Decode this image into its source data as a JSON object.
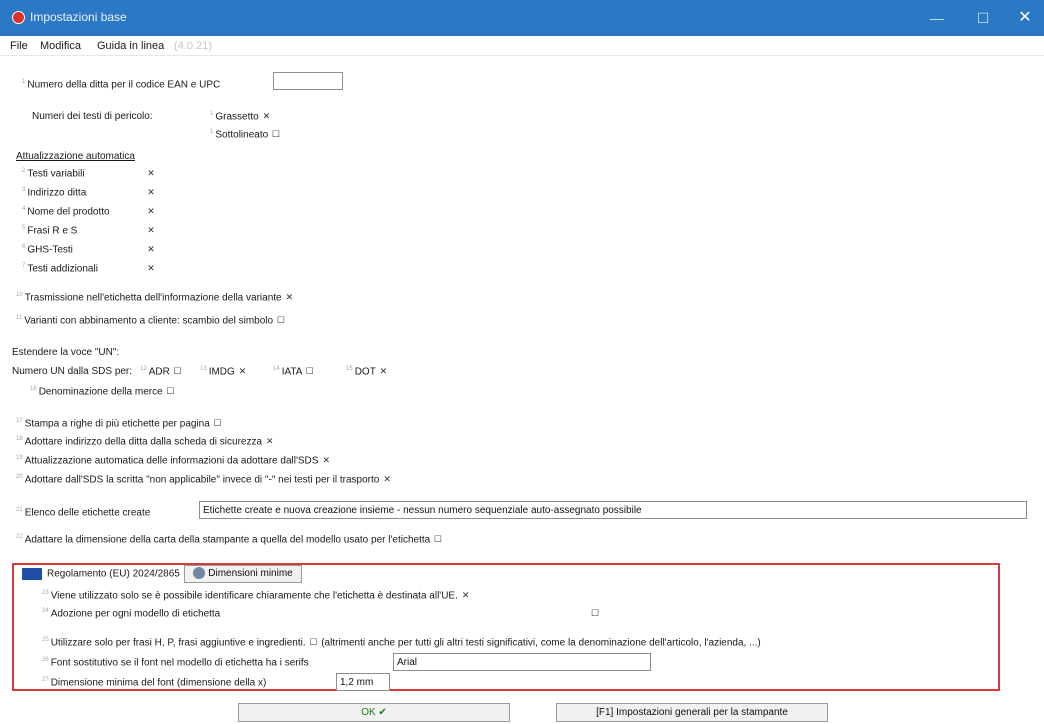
{
  "window": {
    "title": "Impostazioni base",
    "minimize": "—",
    "maximize": "☐",
    "close": "✕"
  },
  "menu": [
    "File",
    "Modifica",
    "Guida in linea",
    "(4.0.21)"
  ],
  "ean": {
    "label": "Numero della ditta per il codice EAN e UPC",
    "value": ""
  },
  "danger_texts": {
    "label": "Numeri dei testi di pericolo:",
    "bold": "Grassetto",
    "bold_check": "✕",
    "underline": "Sottolineato",
    "underline_check": "☐"
  },
  "auto_update": {
    "heading": "Attualizzazione automatica",
    "items": [
      {
        "label": "Testi variabili",
        "check": "✕"
      },
      {
        "label": "Indirizzo ditta",
        "check": "✕"
      },
      {
        "label": "Nome del prodotto",
        "check": "✕"
      },
      {
        "label": "Frasi R e S",
        "check": "✕"
      },
      {
        "label": "GHS-Testi",
        "check": "✕"
      },
      {
        "label": "Testi addizionali",
        "check": "✕"
      }
    ]
  },
  "variant_transmission": {
    "label": "Trasmissione nell'etichetta dell'informazione della variante",
    "check": "✕"
  },
  "variant_symbol": {
    "label": "Varianti con abbinamento a cliente: scambio del simbolo",
    "check": "☐"
  },
  "un": {
    "heading": "Estendere la voce \"UN\":",
    "label": "Numero UN dalla SDS per:",
    "options": [
      {
        "label": "ADR",
        "check": "☐"
      },
      {
        "label": "IMDG",
        "check": "✕"
      },
      {
        "label": "IATA",
        "check": "☐"
      },
      {
        "label": "DOT",
        "check": "✕"
      }
    ],
    "brand_label": "Denominazione della merce",
    "brand_check": "☐"
  },
  "print_rows": {
    "label": "Stampa a righe di più etichette per pagina",
    "check": "☐"
  },
  "adopt_address": {
    "label": "Adottare indirizzo della ditta dalla scheda di sicurezza",
    "check": "✕"
  },
  "auto_update_sds": {
    "label": "Attualizzazione automatica delle informazioni da adottare dall'SDS",
    "check": "✕"
  },
  "not_applicable": {
    "label": "Adottare dall'SDS la scritta \"non applicabile\" invece di \"-\" nei testi per il trasporto",
    "check": "✕"
  },
  "labels_list": {
    "label": "Elenco delle etichette create",
    "value": "Etichette create e nuova creazione insieme - nessun numero sequenziale auto-assegnato possibile"
  },
  "adapt_paper": {
    "label": "Adattare la dimensione della carta della stampante a quella del modello usato per l'etichetta",
    "check": "☐"
  },
  "regulation": {
    "title": "Regolamento (EU) 2024/2865",
    "min_button": "Dimensioni minime",
    "only_eu": {
      "label": "Viene utilizzato solo se è possibile identificare chiaramente che l'etichetta è destinata all'UE.",
      "check": "✕"
    },
    "per_model": {
      "label": "Adozione per ogni modello di etichetta",
      "check": "☐"
    },
    "only_h_p": {
      "label": "Utilizzare solo per frasi H, P, frasi aggiuntive e ingredienti.",
      "check": "☐",
      "note": "(altrimenti anche per tutti gli altri testi significativi, come la denominazione dell'articolo, l'azienda, ...)"
    },
    "substitute_font": {
      "label": "Font sostitutivo se il font nel modello di etichetta ha i serifs",
      "value": "Arial"
    },
    "min_font": {
      "label": "Dimensione minima del font (dimensione della x)",
      "value": "1,2 mm"
    }
  },
  "buttons": {
    "ok": "OK ✔",
    "printer": "[F1] Impostazioni generali per la stampante"
  }
}
